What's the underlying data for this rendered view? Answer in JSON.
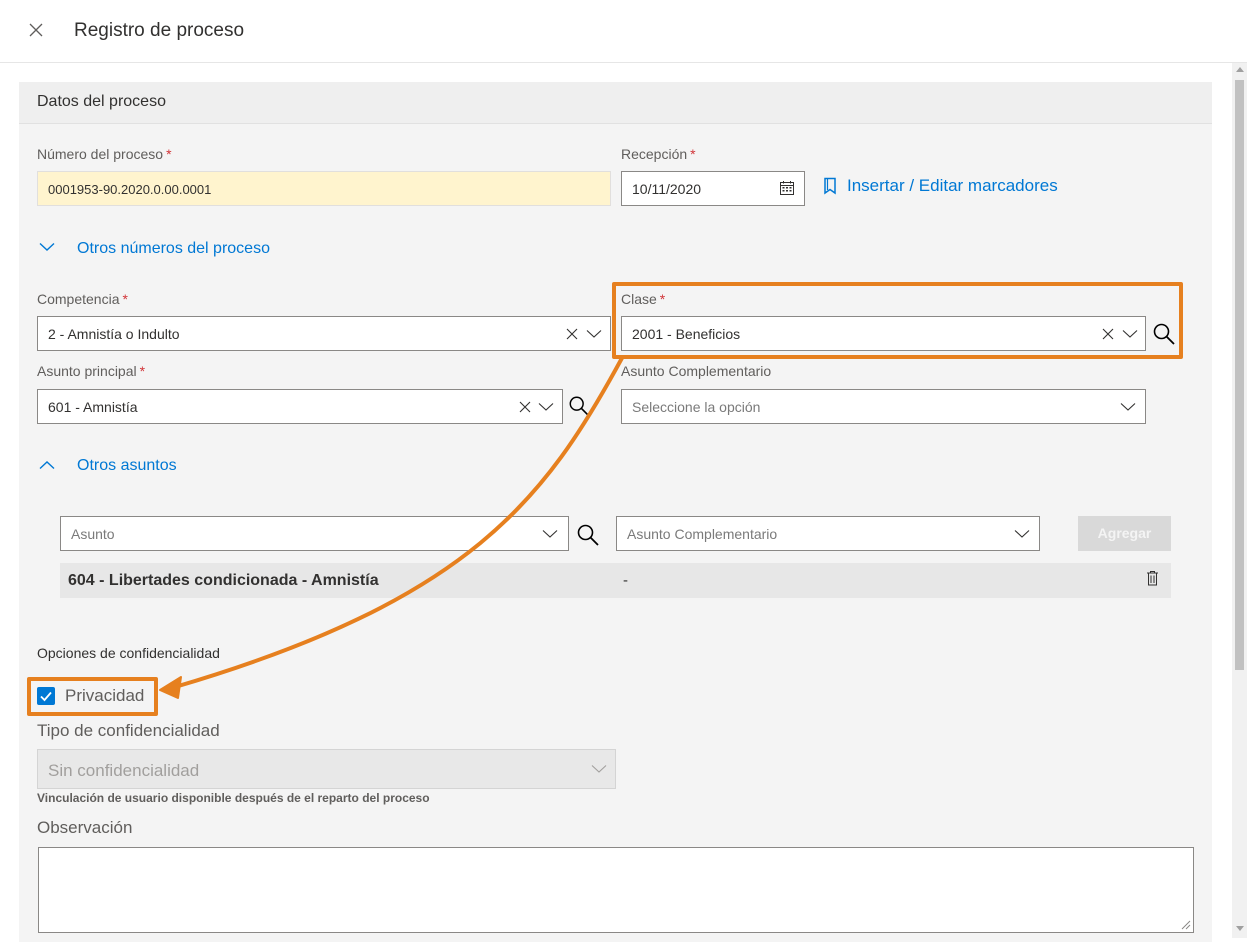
{
  "dialog": {
    "title": "Registro de proceso"
  },
  "process_data": {
    "section_title": "Datos del proceso",
    "process_number": {
      "label": "Número del proceso",
      "required_mark": "*",
      "value": "0001953-90.2020.0.00.0001"
    },
    "reception": {
      "label": "Recepción",
      "required_mark": "*",
      "value": "10/11/2020"
    },
    "bookmarks_link": "Insertar / Editar marcadores",
    "other_numbers_toggle": "Otros números del proceso",
    "competencia": {
      "label": "Competencia",
      "required_mark": "*",
      "value": "2 - Amnistía o Indulto"
    },
    "clase": {
      "label": "Clase",
      "required_mark": "*",
      "value": "2001 - Beneficios"
    },
    "asunto_principal": {
      "label": "Asunto principal",
      "required_mark": "*",
      "value": "601 - Amnistía"
    },
    "asunto_complementario": {
      "label": "Asunto Complementario",
      "placeholder": "Seleccione la opción"
    },
    "other_subjects_toggle": "Otros asuntos",
    "other_subjects": {
      "asunto_placeholder": "Asunto",
      "complementario_placeholder": "Asunto Complementario",
      "add_button": "Agregar",
      "rows": [
        {
          "asunto": "604 - Libertades condicionada - Amnistía",
          "complementario": "-"
        }
      ]
    }
  },
  "confidentiality": {
    "title": "Opciones de confidencialidad",
    "privacy_label": "Privacidad",
    "privacy_checked": true,
    "type_label": "Tipo de confidencialidad",
    "type_value": "Sin confidencialidad",
    "note": "Vinculación de usuario disponible después de el reparto del proceso",
    "observation_label": "Observación"
  },
  "colors": {
    "accent": "#0078d4",
    "highlight": "#e6801f",
    "required": "#d13438",
    "process_number_bg": "#fff4ce"
  }
}
